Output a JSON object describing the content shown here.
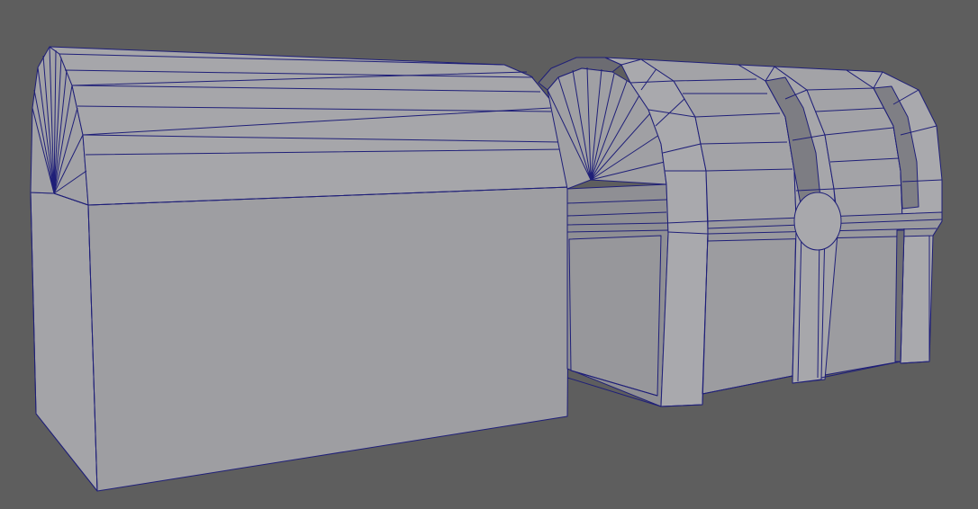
{
  "viewport": {
    "background_color": "#5e5e5e",
    "wireframe_color": "#1f1f78"
  },
  "models": [
    {
      "name": "chest-blockout",
      "style": "smooth-shaded-wireframe"
    },
    {
      "name": "chest-detailed",
      "style": "smooth-shaded-wireframe"
    }
  ],
  "palette": {
    "face_light": "#a8a8ab",
    "face_mid": "#9d9da1",
    "face_dark": "#8e8e93",
    "face_shadow": "#7f7f85",
    "face_deep": "#6a6a70"
  }
}
